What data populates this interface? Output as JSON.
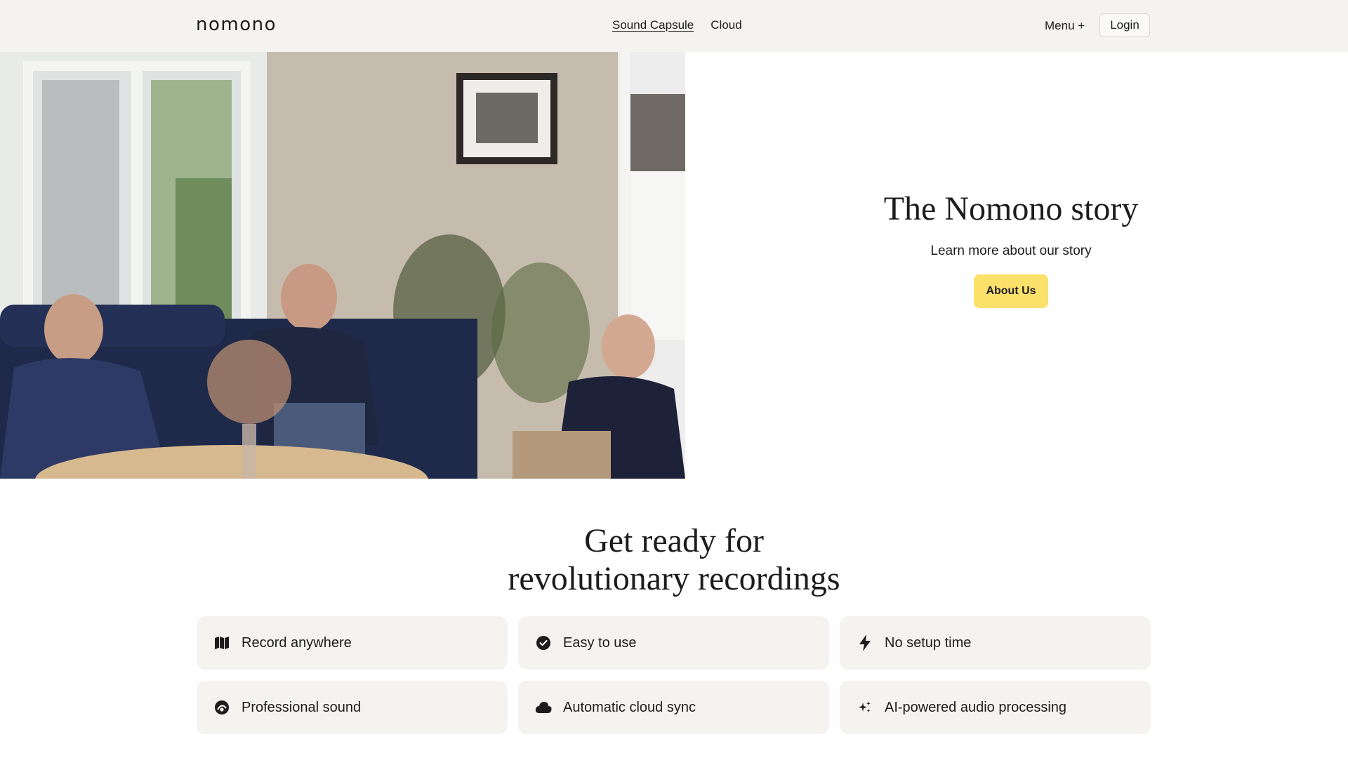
{
  "header": {
    "logo": "nomono",
    "nav": [
      {
        "label": "Sound Capsule",
        "active": true
      },
      {
        "label": "Cloud",
        "active": false
      }
    ],
    "menu_label": "Menu +",
    "login_label": "Login"
  },
  "hero": {
    "title": "The Nomono story",
    "subtitle": "Learn more about our story",
    "button_label": "About Us",
    "button_color": "#fbe06a"
  },
  "features": {
    "title_line1": "Get ready for",
    "title_line2": "revolutionary recordings",
    "items": [
      {
        "label": "Record anywhere",
        "icon": "map-icon"
      },
      {
        "label": "Easy to use",
        "icon": "check-circle-icon"
      },
      {
        "label": "No setup time",
        "icon": "bolt-icon"
      },
      {
        "label": "Professional sound",
        "icon": "sound-icon"
      },
      {
        "label": "Automatic cloud sync",
        "icon": "cloud-icon"
      },
      {
        "label": "AI-powered audio processing",
        "icon": "sparkles-icon"
      }
    ]
  },
  "colors": {
    "header_bg": "#f5f3f0",
    "card_bg": "#f5f3f0",
    "text": "#1c1c1c"
  }
}
